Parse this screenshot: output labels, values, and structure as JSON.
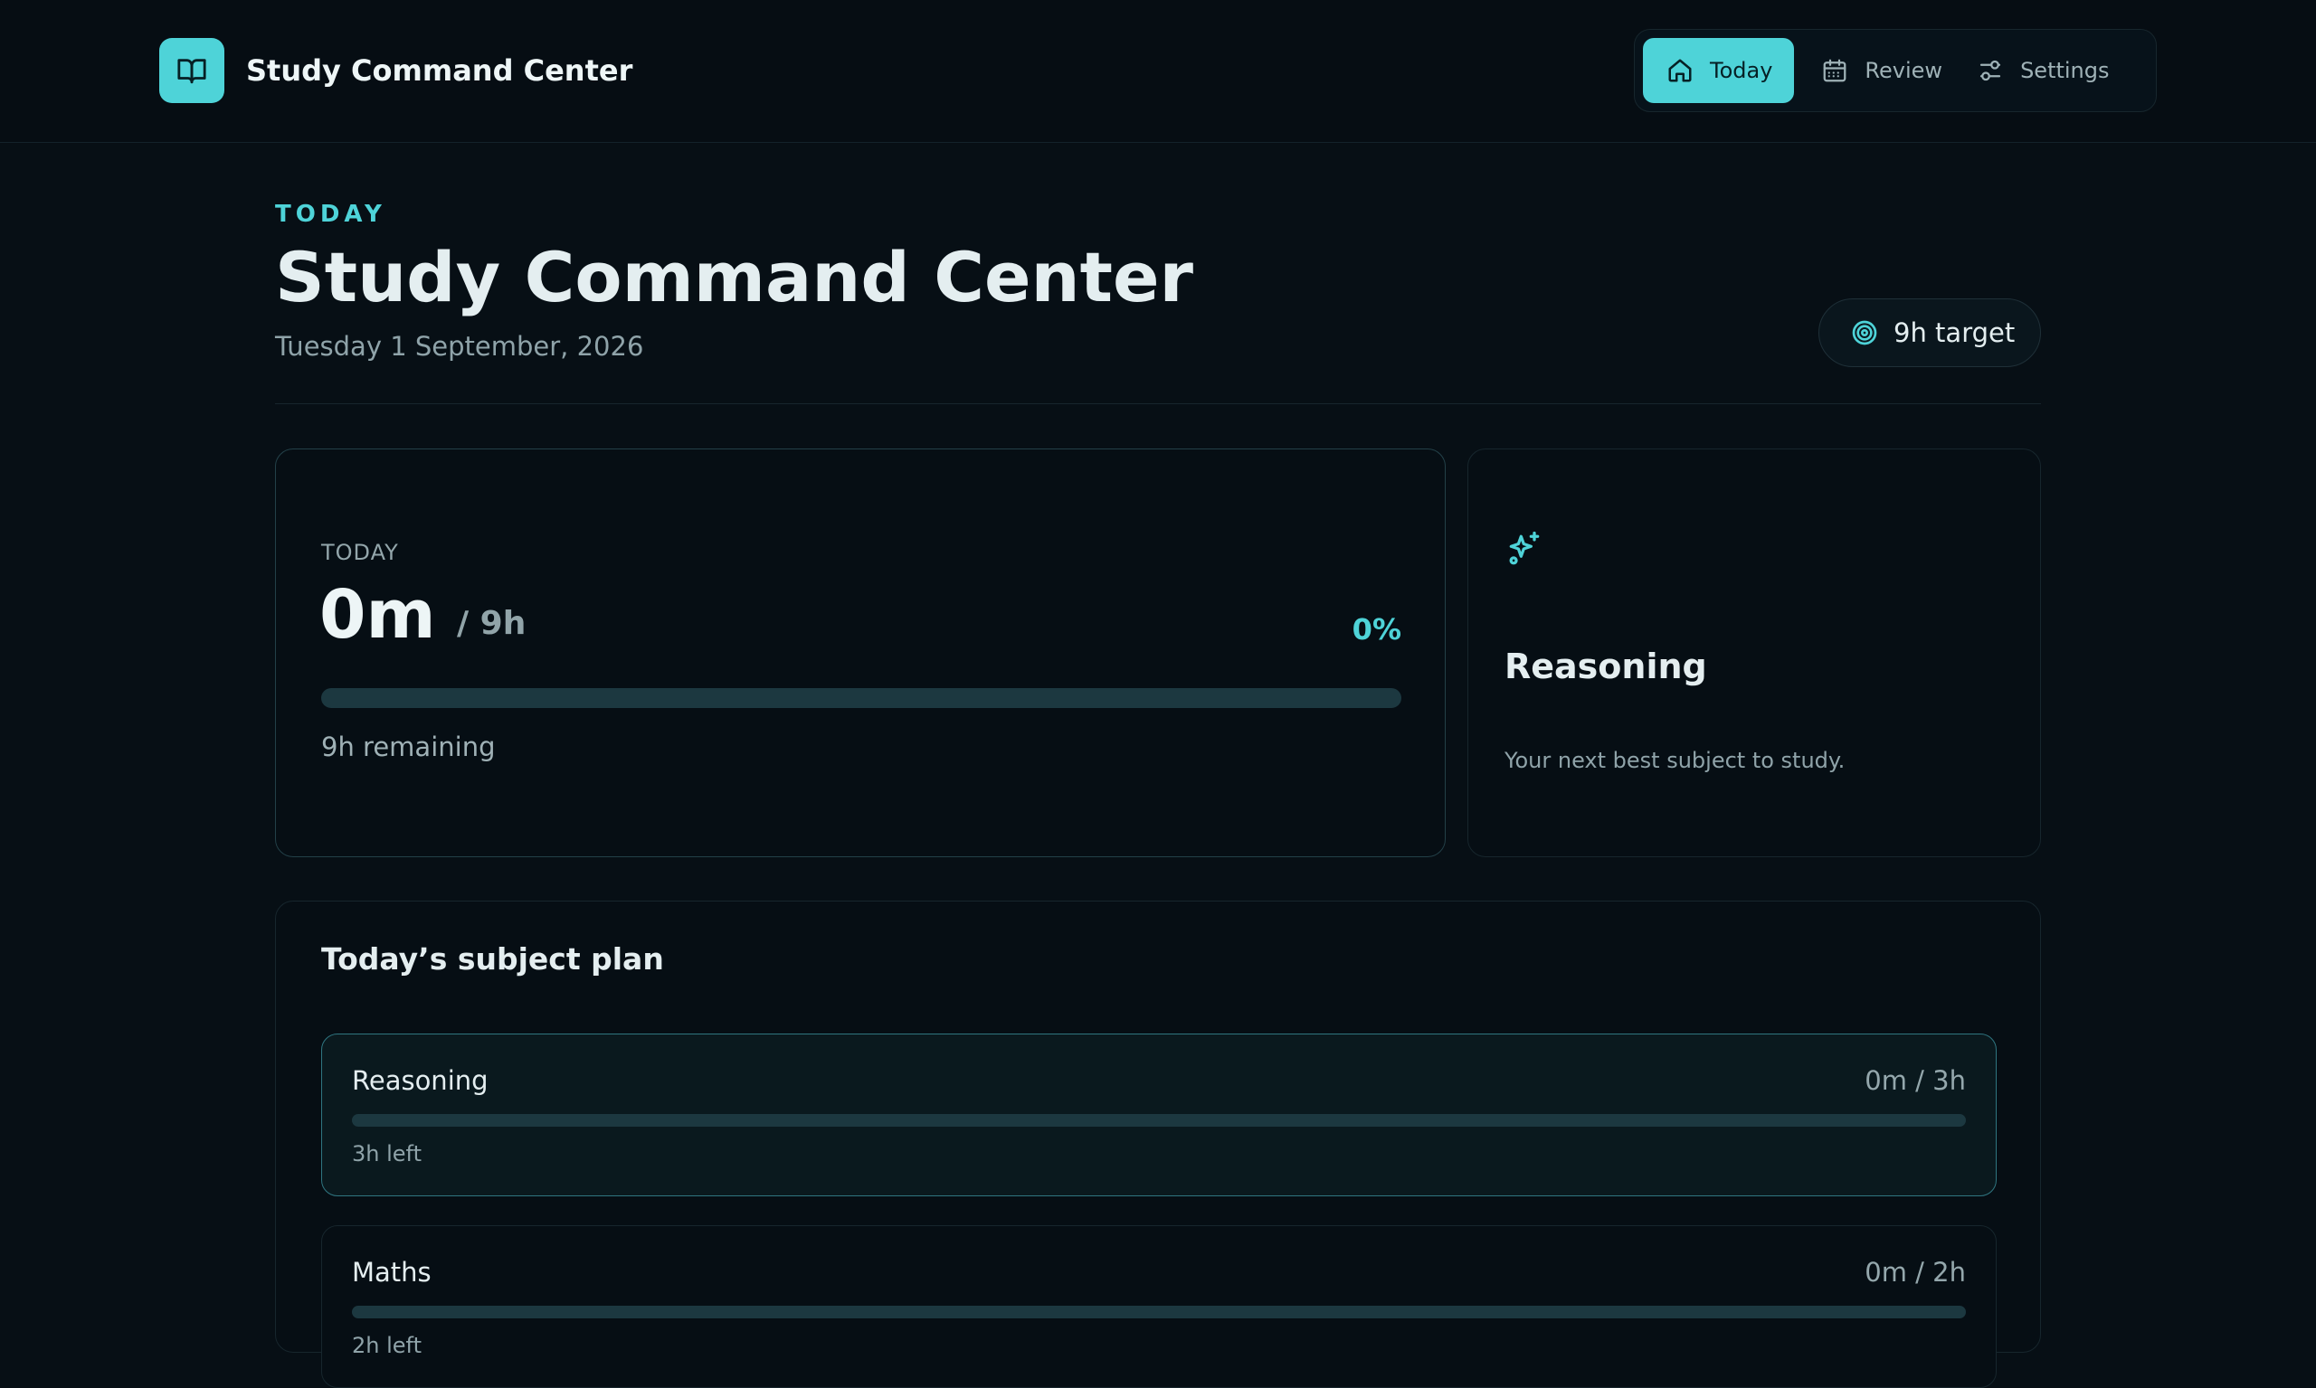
{
  "app": {
    "name": "Study Command Center",
    "icons": {
      "logo": "open-book-icon"
    }
  },
  "nav": {
    "items": [
      {
        "label": "Today",
        "icon": "home-icon",
        "active": true
      },
      {
        "label": "Review",
        "icon": "calendar-icon",
        "active": false
      },
      {
        "label": "Settings",
        "icon": "sliders-icon",
        "active": false
      }
    ]
  },
  "header": {
    "eyebrow": "TODAY",
    "title": "Study Command Center",
    "date": "Tuesday 1 September, 2026",
    "target_pill": {
      "label": "9h target",
      "icon": "target-icon"
    }
  },
  "progress": {
    "label": "TODAY",
    "studied": "0m",
    "target": "/ 9h",
    "percent_text": "0%",
    "fraction": 0,
    "remaining": "9h remaining"
  },
  "suggestion": {
    "icon": "sparkles-icon",
    "subject": "Reasoning",
    "caption": "Your next best subject to study."
  },
  "plan": {
    "title": "Today’s subject plan",
    "subjects": [
      {
        "name": "Reasoning",
        "time": "0m / 3h",
        "left": "3h left",
        "fraction": 0,
        "active": true
      },
      {
        "name": "Maths",
        "time": "0m / 2h",
        "left": "2h left",
        "fraction": 0,
        "active": false
      }
    ]
  },
  "colors": {
    "accent": "#4ed3d8",
    "background": "#070f15",
    "card_border": "#17262d",
    "track": "#1c3840"
  }
}
